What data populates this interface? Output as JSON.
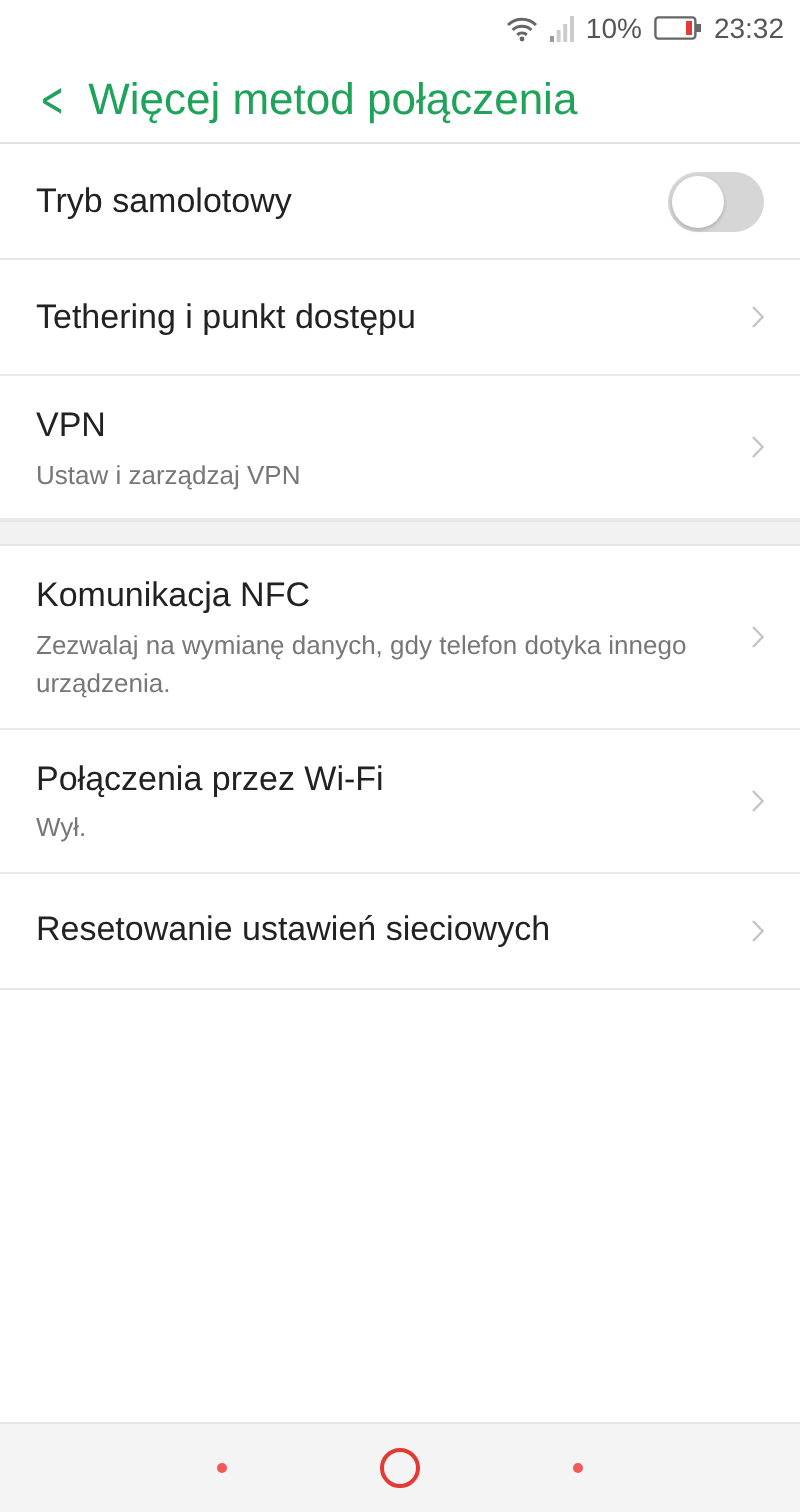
{
  "status_bar": {
    "battery_text": "10%",
    "time": "23:32"
  },
  "header": {
    "back": "<",
    "title": "Więcej metod połączenia"
  },
  "sections": [
    {
      "items": [
        {
          "kind": "toggle",
          "label": "Tryb samolotowy",
          "on": false
        },
        {
          "kind": "link",
          "label": "Tethering i punkt dostępu"
        },
        {
          "kind": "link",
          "label": "VPN",
          "subtitle": "Ustaw i zarządzaj VPN"
        }
      ]
    },
    {
      "items": [
        {
          "kind": "link",
          "label": "Komunikacja NFC",
          "subtitle": "Zezwalaj na wymianę danych, gdy telefon dotyka innego urządzenia."
        },
        {
          "kind": "link",
          "label": "Połączenia przez Wi-Fi",
          "subtitle": "Wył."
        },
        {
          "kind": "link",
          "label": "Resetowanie ustawień sieciowych"
        }
      ]
    }
  ]
}
